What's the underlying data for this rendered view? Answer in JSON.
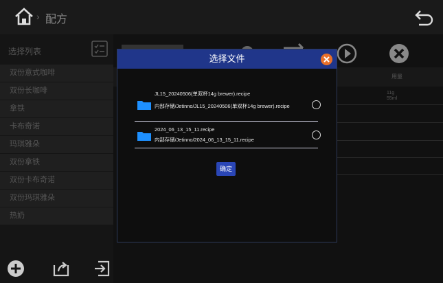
{
  "header": {
    "title": "配方",
    "breadcrumb_separator": "›",
    "home_icon": "home-icon",
    "back_icon": "back-arrow-icon"
  },
  "sidebar": {
    "title": "选择列表",
    "items": [
      {
        "label": "双份意式咖啡"
      },
      {
        "label": "双份长咖啡"
      },
      {
        "label": "拿铁"
      },
      {
        "label": "卡布奇诺"
      },
      {
        "label": "玛琪雅朵"
      },
      {
        "label": "双份拿铁"
      },
      {
        "label": "双份卡布奇诺"
      },
      {
        "label": "双份玛琪雅朵"
      },
      {
        "label": "热奶"
      }
    ],
    "footer_icons": [
      "add-icon",
      "export-icon",
      "import-icon"
    ]
  },
  "content": {
    "column_header": "用量",
    "first_row_values": [
      "11g",
      "55ml"
    ]
  },
  "dialog": {
    "title": "选择文件",
    "files": [
      {
        "name": "JL15_20240506(单双杯14g brewer).recipe",
        "path": "内部存储/Jetinno/JL15_20240506(单双杯14g brewer).recipe",
        "selected": false
      },
      {
        "name": "2024_06_13_15_11.recipe",
        "path": "内部存储/Jetinno/2024_06_13_15_11.recipe",
        "selected": false
      }
    ],
    "confirm_label": "确定"
  },
  "colors": {
    "dialog_header": "#20368a",
    "close_button": "#e8702a",
    "folder": "#1e90ff",
    "confirm_button": "#2a46b6"
  }
}
